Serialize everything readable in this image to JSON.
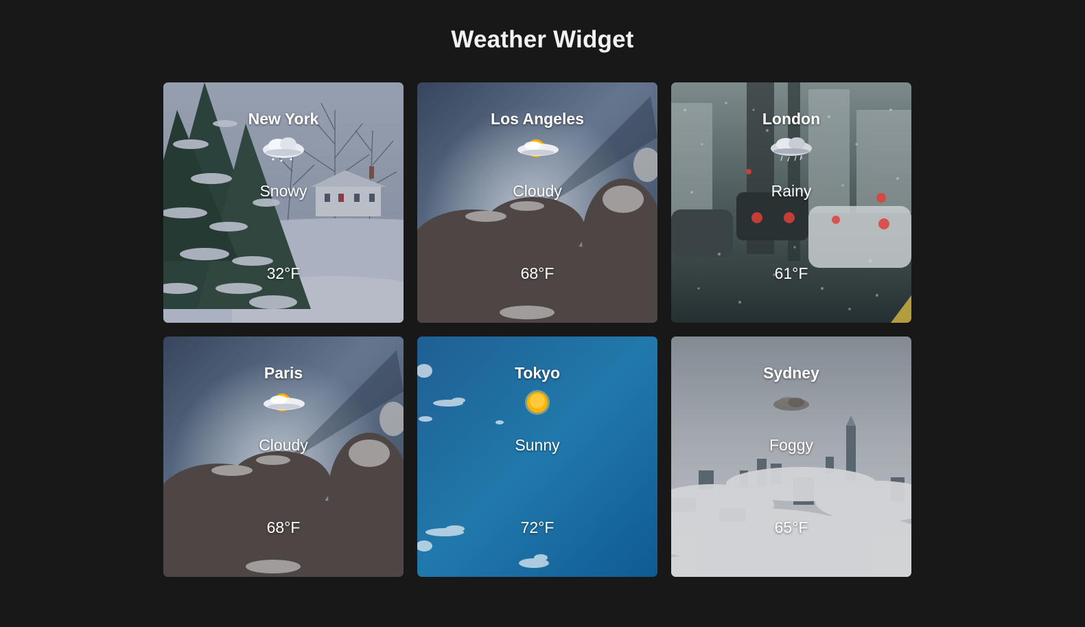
{
  "page": {
    "title": "Weather Widget"
  },
  "cards": [
    {
      "city": "New York",
      "condition": "Snowy",
      "temperature": "32°F",
      "icon": "snow-cloud-icon",
      "background": "snowy-forest"
    },
    {
      "city": "Los Angeles",
      "condition": "Cloudy",
      "temperature": "68°F",
      "icon": "partly-cloudy-icon",
      "background": "storm-clouds"
    },
    {
      "city": "London",
      "condition": "Rainy",
      "temperature": "61°F",
      "icon": "rain-cloud-icon",
      "background": "rainy-window-street"
    },
    {
      "city": "Paris",
      "condition": "Cloudy",
      "temperature": "68°F",
      "icon": "partly-cloudy-icon",
      "background": "storm-clouds"
    },
    {
      "city": "Tokyo",
      "condition": "Sunny",
      "temperature": "72°F",
      "icon": "sun-icon",
      "background": "blue-sky"
    },
    {
      "city": "Sydney",
      "condition": "Foggy",
      "temperature": "65°F",
      "icon": "fog-icon",
      "background": "foggy-city"
    }
  ],
  "colors": {
    "page_background": "#181818",
    "text": "#ffffff",
    "sky_blue": "#1a6aa0",
    "sun": "#ffb300"
  }
}
